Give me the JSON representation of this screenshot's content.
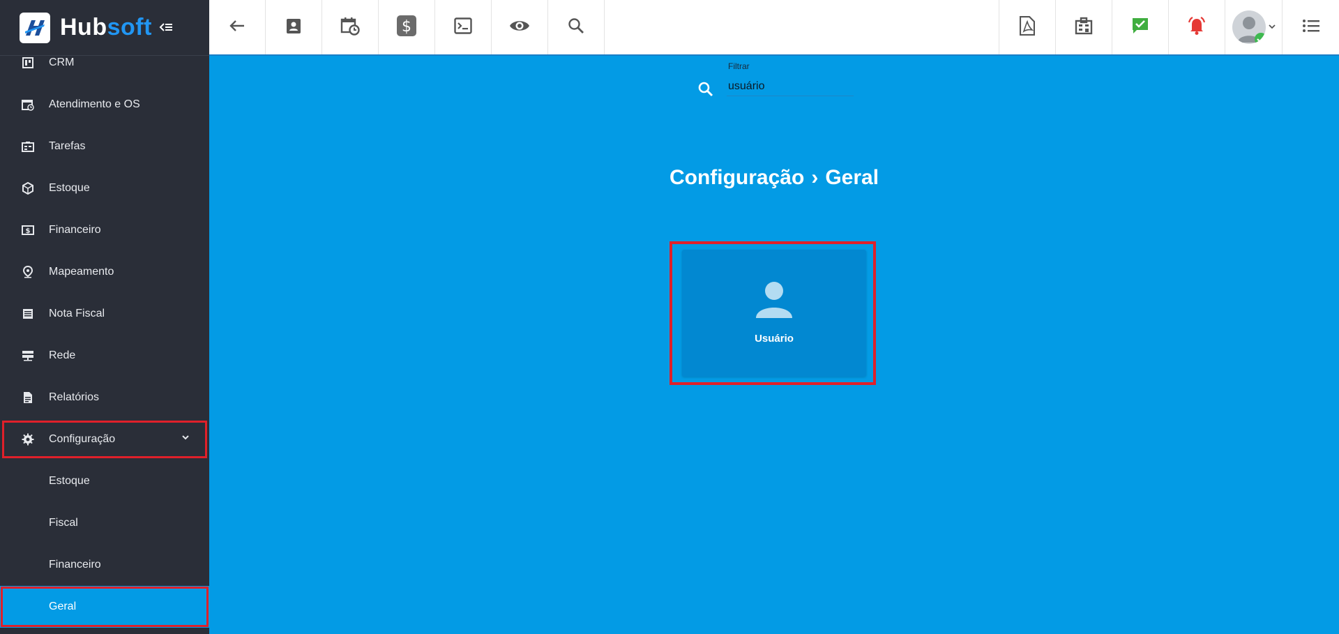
{
  "brand": {
    "name_part1": "Hub",
    "name_part2": "soft"
  },
  "sidebar": {
    "items": [
      {
        "label": "CRM",
        "icon": "crm-board-icon"
      },
      {
        "label": "Atendimento e OS",
        "icon": "calendar-clock-icon"
      },
      {
        "label": "Tarefas",
        "icon": "tasks-icon"
      },
      {
        "label": "Estoque",
        "icon": "box-icon"
      },
      {
        "label": "Financeiro",
        "icon": "money-icon"
      },
      {
        "label": "Mapeamento",
        "icon": "map-pin-icon"
      },
      {
        "label": "Nota Fiscal",
        "icon": "document-list-icon"
      },
      {
        "label": "Rede",
        "icon": "network-icon"
      },
      {
        "label": "Relatórios",
        "icon": "report-icon"
      },
      {
        "label": "Configuração",
        "icon": "gear-icon"
      }
    ],
    "subitems": [
      {
        "label": "Estoque"
      },
      {
        "label": "Fiscal"
      },
      {
        "label": "Financeiro"
      },
      {
        "label": "Geral"
      }
    ]
  },
  "topbar": {
    "left_icons": [
      "back-arrow-icon",
      "contact-icon",
      "calendar-clock-icon",
      "dollar-icon",
      "terminal-icon",
      "eye-icon",
      "search-icon"
    ],
    "right_icons": [
      "pdf-icon",
      "building-icon",
      "check-message-icon",
      "alarm-icon",
      "user-avatar",
      "menu-list-icon"
    ]
  },
  "filter": {
    "label": "Filtrar",
    "value": "usuário"
  },
  "breadcrumb": {
    "part1": "Configuração",
    "separator": "›",
    "part2": "Geral"
  },
  "card": {
    "label": "Usuário",
    "icon": "user-icon"
  },
  "colors": {
    "accent": "#039be5",
    "card": "#0288d1",
    "sidebar": "#2a2e38",
    "highlight": "#e0202a"
  }
}
